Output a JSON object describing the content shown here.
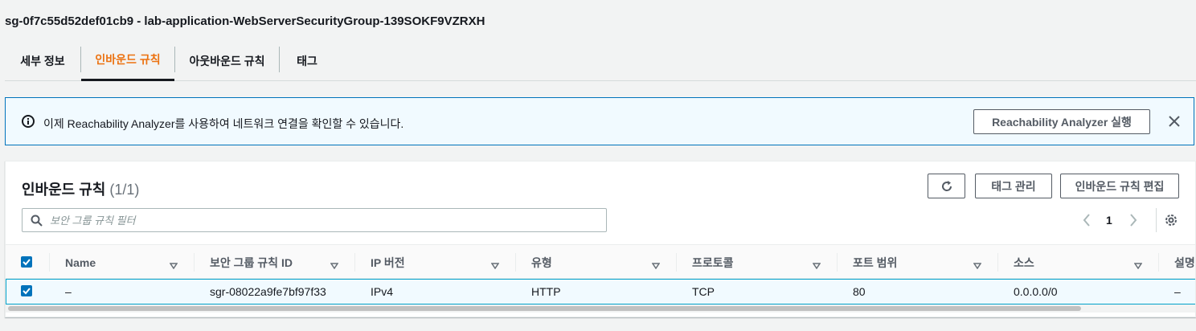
{
  "page": {
    "title": "sg-0f7c55d52def01cb9 - lab-application-WebServerSecurityGroup-139SOKF9VZRXH"
  },
  "tabs": [
    {
      "label": "세부 정보"
    },
    {
      "label": "인바운드 규칙",
      "active": true
    },
    {
      "label": "아웃바운드 규칙"
    },
    {
      "label": "태그"
    }
  ],
  "alert": {
    "message": "이제 Reachability Analyzer를 사용하여 네트워크 연결을 확인할 수 있습니다.",
    "button_label": "Reachability Analyzer 실행",
    "icon": "info-icon"
  },
  "rules_panel": {
    "title": "인바운드 규칙",
    "count": "(1/1)",
    "refresh_icon": "refresh-icon",
    "manage_tags_label": "태그 관리",
    "edit_rules_label": "인바운드 규칙 편집",
    "search": {
      "placeholder": "보안 그룹 규칙 필터",
      "value": ""
    },
    "pagination": {
      "current_page": "1"
    }
  },
  "table": {
    "columns": [
      "Name",
      "보안 그룹 규칙 ID",
      "IP 버전",
      "유형",
      "프로토콜",
      "포트 범위",
      "소스",
      "설명"
    ],
    "rows": [
      {
        "selected": true,
        "cells": [
          "–",
          "sgr-08022a9fe7bf97f33",
          "IPv4",
          "HTTP",
          "TCP",
          "80",
          "0.0.0.0/0",
          "–"
        ]
      }
    ]
  },
  "colors": {
    "accent": "#ec7211",
    "primary_blue": "#0073bb",
    "alert_bg": "#f1faff",
    "row_selected_border": "#00a1c9"
  }
}
